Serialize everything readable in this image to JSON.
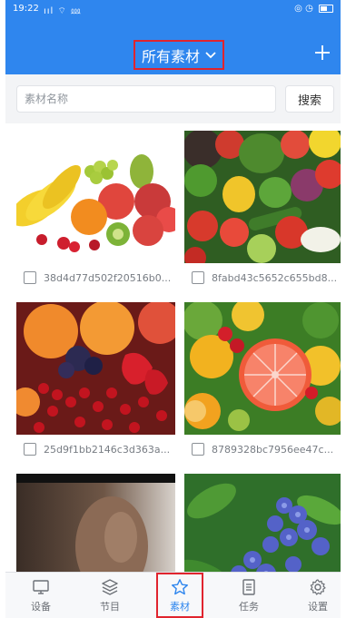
{
  "status_bar": {
    "time": "19:22",
    "signal": "ııl ⌔ ⅏"
  },
  "header": {
    "title": "所有素材"
  },
  "search": {
    "placeholder": "素材名称",
    "button_label": "搜索"
  },
  "materials": [
    {
      "caption": "38d4d77d502f20516b0..."
    },
    {
      "caption": "8fabd43c5652c655bd8..."
    },
    {
      "caption": "25d9f1bb2146c3d363a..."
    },
    {
      "caption": "8789328bc7956ee47c..."
    },
    {
      "caption": ""
    },
    {
      "caption": ""
    }
  ],
  "bottom_nav": [
    {
      "label": "设备",
      "icon": "monitor-icon"
    },
    {
      "label": "节目",
      "icon": "layers-icon"
    },
    {
      "label": "素材",
      "icon": "star-icon",
      "active": true
    },
    {
      "label": "任务",
      "icon": "task-list-icon"
    },
    {
      "label": "设置",
      "icon": "gear-icon"
    }
  ],
  "colors": {
    "primary": "#2f86ee",
    "highlight_border": "#e0242e"
  }
}
